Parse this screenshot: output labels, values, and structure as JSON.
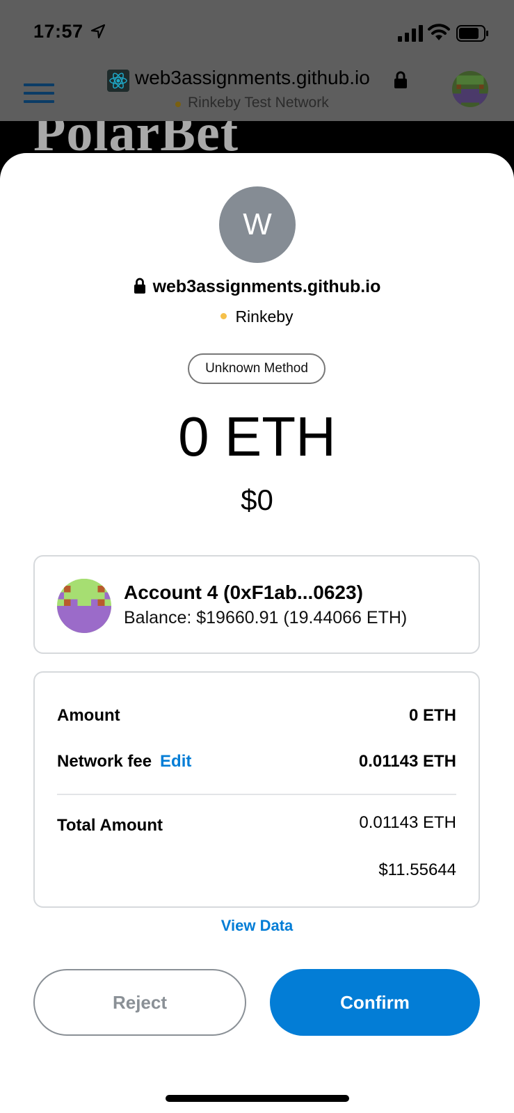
{
  "status_bar": {
    "time": "17:57"
  },
  "browser": {
    "url": "web3assignments.github.io",
    "network": "Rinkeby Test Network",
    "page_heading": "PolarBet"
  },
  "request": {
    "origin_initial": "W",
    "origin_url": "web3assignments.github.io",
    "network_name": "Rinkeby",
    "method_label": "Unknown Method",
    "amount_crypto": "0 ETH",
    "amount_fiat": "$0"
  },
  "account": {
    "name": "Account 4 (0xF1ab...0623)",
    "balance": "Balance: $19660.91 (19.44066 ETH)"
  },
  "fees": {
    "amount_label": "Amount",
    "amount_value": "0 ETH",
    "network_fee_label": "Network fee",
    "edit_label": "Edit",
    "network_fee_value": "0.01143 ETH",
    "total_label": "Total Amount",
    "total_crypto": "0.01143 ETH",
    "total_fiat": "$11.55644"
  },
  "actions": {
    "view_data": "View Data",
    "reject": "Reject",
    "confirm": "Confirm"
  },
  "colors": {
    "accent": "#037dd6",
    "network_dot": "#f5c04a",
    "origin_avatar_bg": "#858c94"
  }
}
